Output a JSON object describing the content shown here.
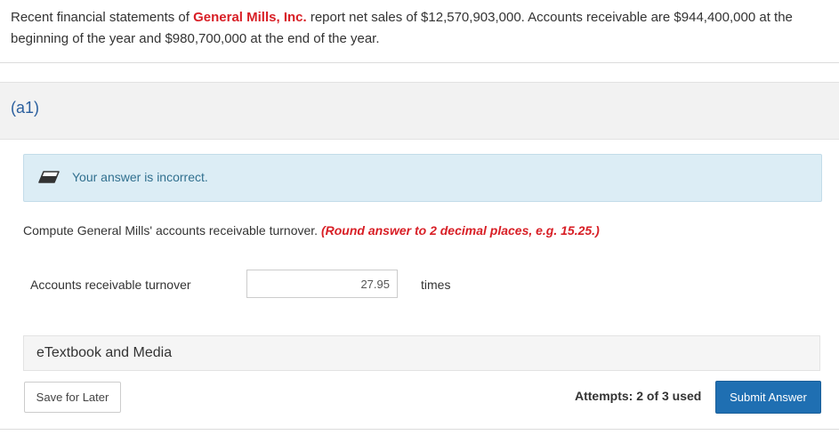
{
  "problem": {
    "prefix": "Recent financial statements of ",
    "company": "General Mills, Inc.",
    "suffix": " report net sales of $12,570,903,000. Accounts receivable are $944,400,000 at the beginning of the year and $980,700,000 at the end of the year."
  },
  "part": {
    "label": "(a1)"
  },
  "feedback": {
    "icon": "eraser-icon",
    "text": "Your answer is incorrect."
  },
  "question": {
    "text": "Compute General Mills' accounts receivable turnover. ",
    "hint": "(Round answer to 2 decimal places, e.g. 15.25.)"
  },
  "answer": {
    "label": "Accounts receivable turnover",
    "value": "27.95",
    "unit": "times"
  },
  "etextbook": {
    "label": "eTextbook and Media"
  },
  "footer": {
    "save_label": "Save for Later",
    "attempts": "Attempts: 2 of 3 used",
    "submit_label": "Submit Answer"
  },
  "colors": {
    "accent": "#1f6fb2",
    "error": "#d81f26",
    "feedback_bg": "#dcedf5"
  }
}
